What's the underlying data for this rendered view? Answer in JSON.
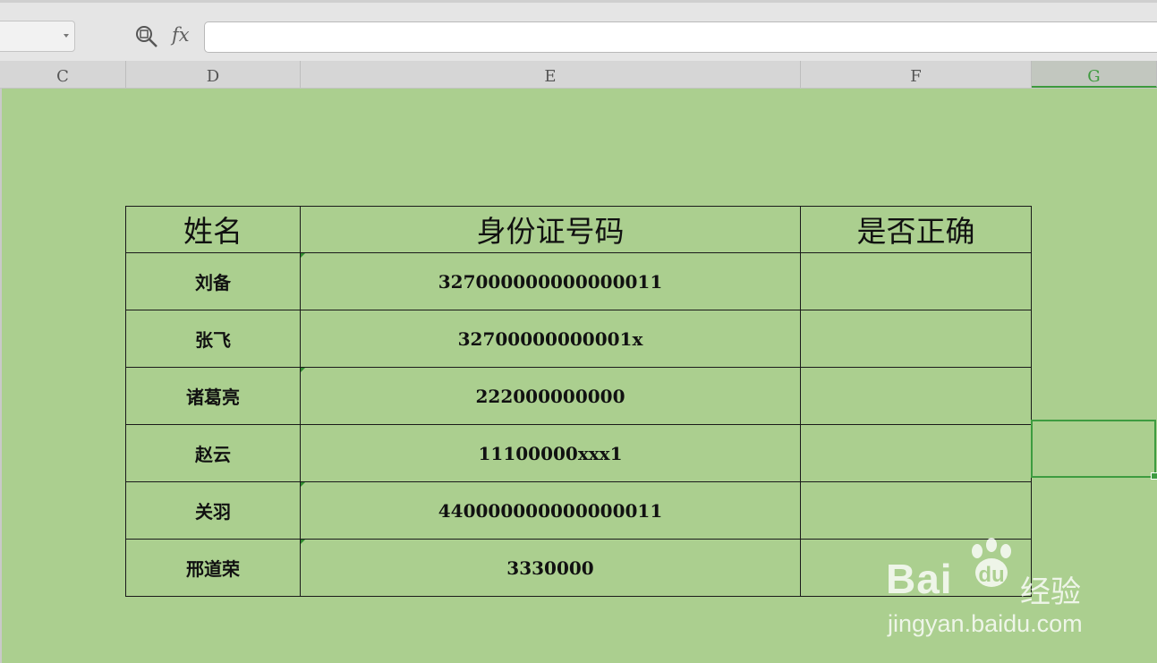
{
  "formula_bar": {
    "fx_label": "fx",
    "formula_value": ""
  },
  "columns": [
    {
      "label": "C"
    },
    {
      "label": "D"
    },
    {
      "label": "E"
    },
    {
      "label": "F"
    },
    {
      "label": "G"
    }
  ],
  "table": {
    "headers": [
      "姓名",
      "身份证号码",
      "是否正确"
    ],
    "rows": [
      {
        "name": "刘备",
        "id": "327000000000000011",
        "correct": ""
      },
      {
        "name": "张飞",
        "id": "32700000000001x",
        "correct": ""
      },
      {
        "name": "诸葛亮",
        "id": "222000000000",
        "correct": ""
      },
      {
        "name": "赵云",
        "id": "11100000xxx1",
        "correct": ""
      },
      {
        "name": "关羽",
        "id": "440000000000000011",
        "correct": ""
      },
      {
        "name": "邢道荣",
        "id": "3330000",
        "correct": ""
      }
    ]
  },
  "watermark": {
    "logo_text": "Bai",
    "logo_suffix": "du",
    "label": "经验",
    "url": "jingyan.baidu.com"
  },
  "colors": {
    "sheet_background": "#abcf8f",
    "selection_accent": "#3d9c40"
  }
}
